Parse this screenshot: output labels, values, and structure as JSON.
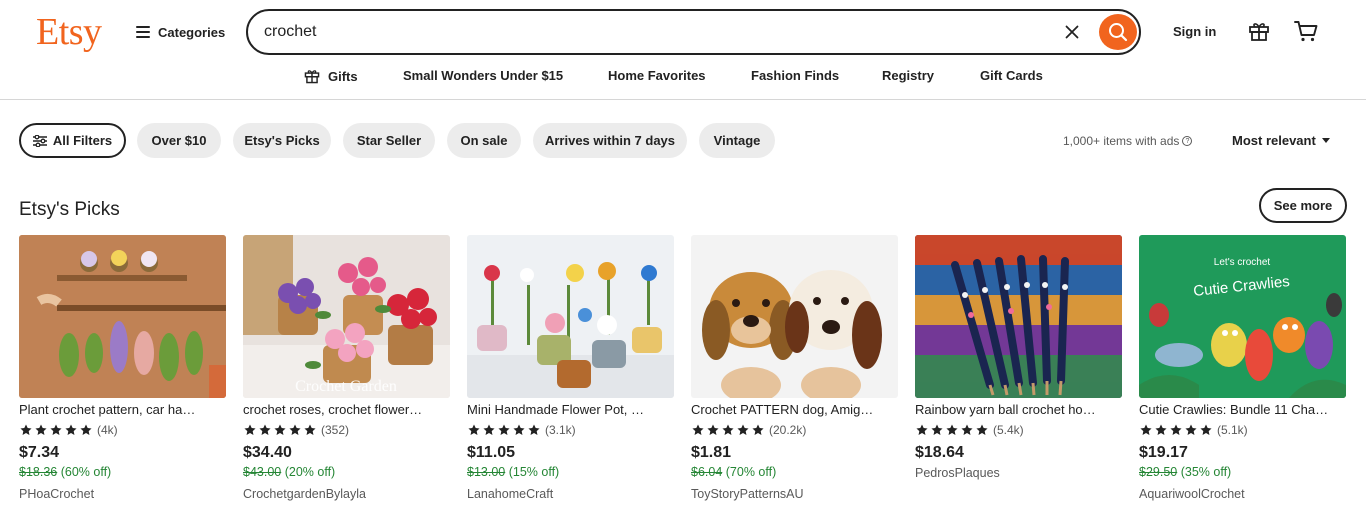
{
  "header": {
    "logo": "Etsy",
    "categories_label": "Categories",
    "search_value": "crochet",
    "sign_in_label": "Sign in",
    "accent_color": "#f1641e"
  },
  "subnav": {
    "items": [
      {
        "label": "Gifts",
        "icon": "gift-icon"
      },
      {
        "label": "Small Wonders Under $15"
      },
      {
        "label": "Home Favorites"
      },
      {
        "label": "Fashion Finds"
      },
      {
        "label": "Registry"
      },
      {
        "label": "Gift Cards"
      }
    ]
  },
  "filters": {
    "all_filters_label": "All Filters",
    "pills": [
      "Over $10",
      "Etsy's Picks",
      "Star Seller",
      "On sale",
      "Arrives within 7 days",
      "Vintage"
    ],
    "items_info": "1,000+ items with ads",
    "sort_label": "Most relevant"
  },
  "section": {
    "title": "Etsy's Picks",
    "see_more_label": "See more"
  },
  "products": [
    {
      "title": "Plant crochet pattern, car ha…",
      "rating": 5,
      "reviews": "(4k)",
      "price": "$7.34",
      "original_price": "$18.36",
      "discount": "(60% off)",
      "shop": "PHoaCrochet"
    },
    {
      "title": "crochet roses, crochet flower…",
      "rating": 5,
      "reviews": "(352)",
      "price": "$34.40",
      "original_price": "$43.00",
      "discount": "(20% off)",
      "shop": "CrochetgardenBylayla",
      "image_caption": "Crochet Garden"
    },
    {
      "title": "Mini Handmade Flower Pot, …",
      "rating": 5,
      "reviews": "(3.1k)",
      "price": "$11.05",
      "original_price": "$13.00",
      "discount": "(15% off)",
      "shop": "LanahomeCraft"
    },
    {
      "title": "Crochet PATTERN dog, Amig…",
      "rating": 5,
      "reviews": "(20.2k)",
      "price": "$1.81",
      "original_price": "$6.04",
      "discount": "(70% off)",
      "shop": "ToyStoryPatternsAU"
    },
    {
      "title": "Rainbow yarn ball crochet ho…",
      "rating": 5,
      "reviews": "(5.4k)",
      "price": "$18.64",
      "original_price": "",
      "discount": "",
      "shop": "PedrosPlaques"
    },
    {
      "title": "Cutie Crawlies: Bundle 11 Cha…",
      "rating": 5,
      "reviews": "(5.1k)",
      "price": "$19.17",
      "original_price": "$29.50",
      "discount": "(35% off)",
      "shop": "AquariwoolCrochet",
      "image_caption_top": "Let's crochet",
      "image_caption": "Cutie Crawlies"
    }
  ]
}
